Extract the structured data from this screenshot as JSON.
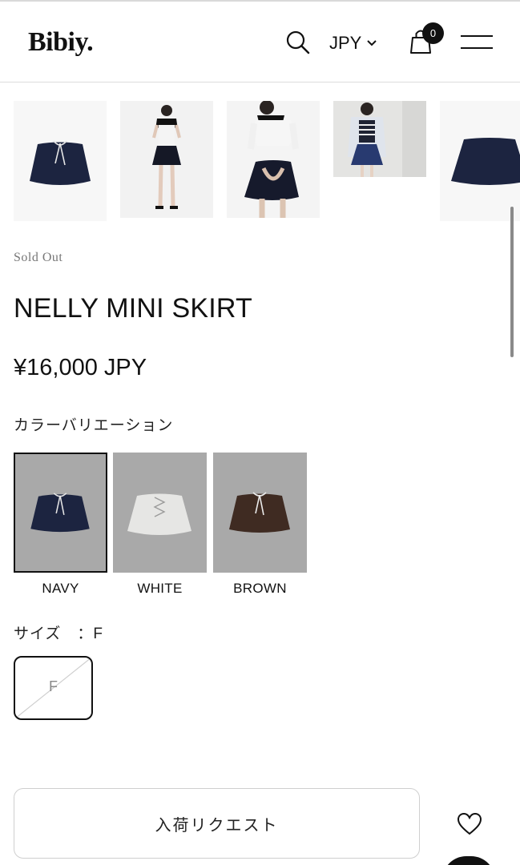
{
  "header": {
    "logo": "Bibiy.",
    "currency": "JPY",
    "cart_count": "0"
  },
  "product": {
    "status": "Sold Out",
    "title": "NELLY MINI SKIRT",
    "price": "¥16,000 JPY"
  },
  "colors": {
    "heading": "カラーバリエーション",
    "options": [
      {
        "label": "NAVY",
        "skirt_color": "#1c2440",
        "selected": true
      },
      {
        "label": "WHITE",
        "skirt_color": "#e6e6e4",
        "selected": false
      },
      {
        "label": "BROWN",
        "skirt_color": "#3f2b22",
        "selected": false
      }
    ]
  },
  "size": {
    "heading": "サイズ　：F",
    "options": [
      {
        "label": "F",
        "available": false
      }
    ]
  },
  "actions": {
    "request_label": "入荷リクエスト"
  },
  "theme": {
    "navy": "#1c2440",
    "swatch_bg": "#a9a9a9",
    "text": "#111111",
    "muted": "#777777"
  }
}
